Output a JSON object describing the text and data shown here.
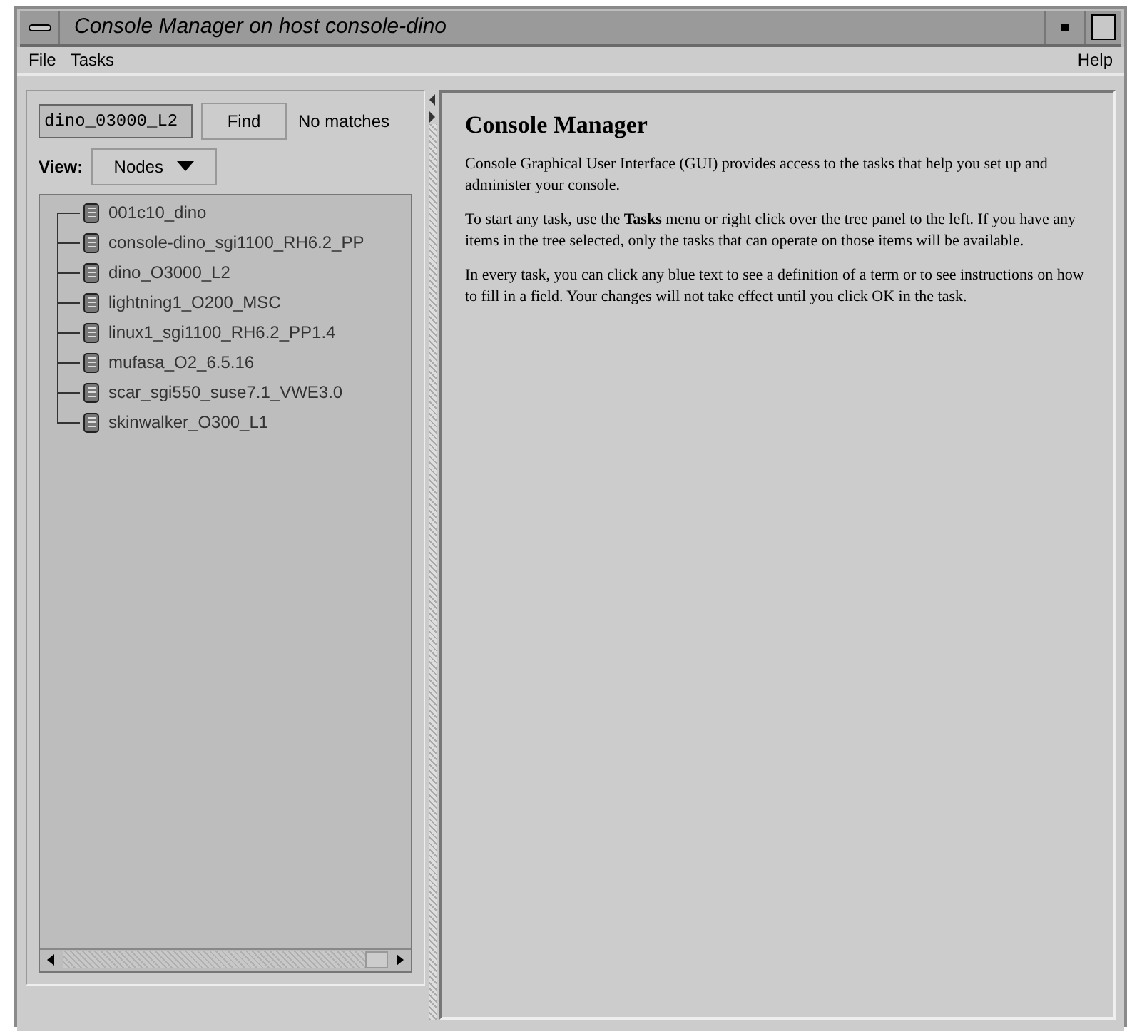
{
  "window": {
    "title": "Console Manager on host console-dino"
  },
  "menu": {
    "left": [
      "File",
      "Tasks"
    ],
    "right": [
      "Help"
    ]
  },
  "find": {
    "value": "dino_03000_L2",
    "button": "Find",
    "result": "No matches"
  },
  "view": {
    "label": "View:",
    "value": "Nodes"
  },
  "tree": {
    "items": [
      {
        "label": "001c10_dino"
      },
      {
        "label": "console-dino_sgi1100_RH6.2_PP"
      },
      {
        "label": "dino_O3000_L2"
      },
      {
        "label": "lightning1_O200_MSC"
      },
      {
        "label": "linux1_sgi1100_RH6.2_PP1.4"
      },
      {
        "label": "mufasa_O2_6.5.16"
      },
      {
        "label": "scar_sgi550_suse7.1_VWE3.0"
      },
      {
        "label": "skinwalker_O300_L1"
      }
    ]
  },
  "help": {
    "heading": "Console Manager",
    "paragraphs": [
      "Console Graphical User Interface (GUI) provides access to the tasks that help you set up and administer your console.",
      "To start any task, use the **Tasks** menu or right click over the tree panel to the left. If you have any items in the tree selected, only the tasks that can operate on those items will be available.",
      "In every task, you can click any blue text to see a definition of a term or to see instructions on how to fill in a field.  Your changes will not take effect until you click OK in the task."
    ]
  }
}
